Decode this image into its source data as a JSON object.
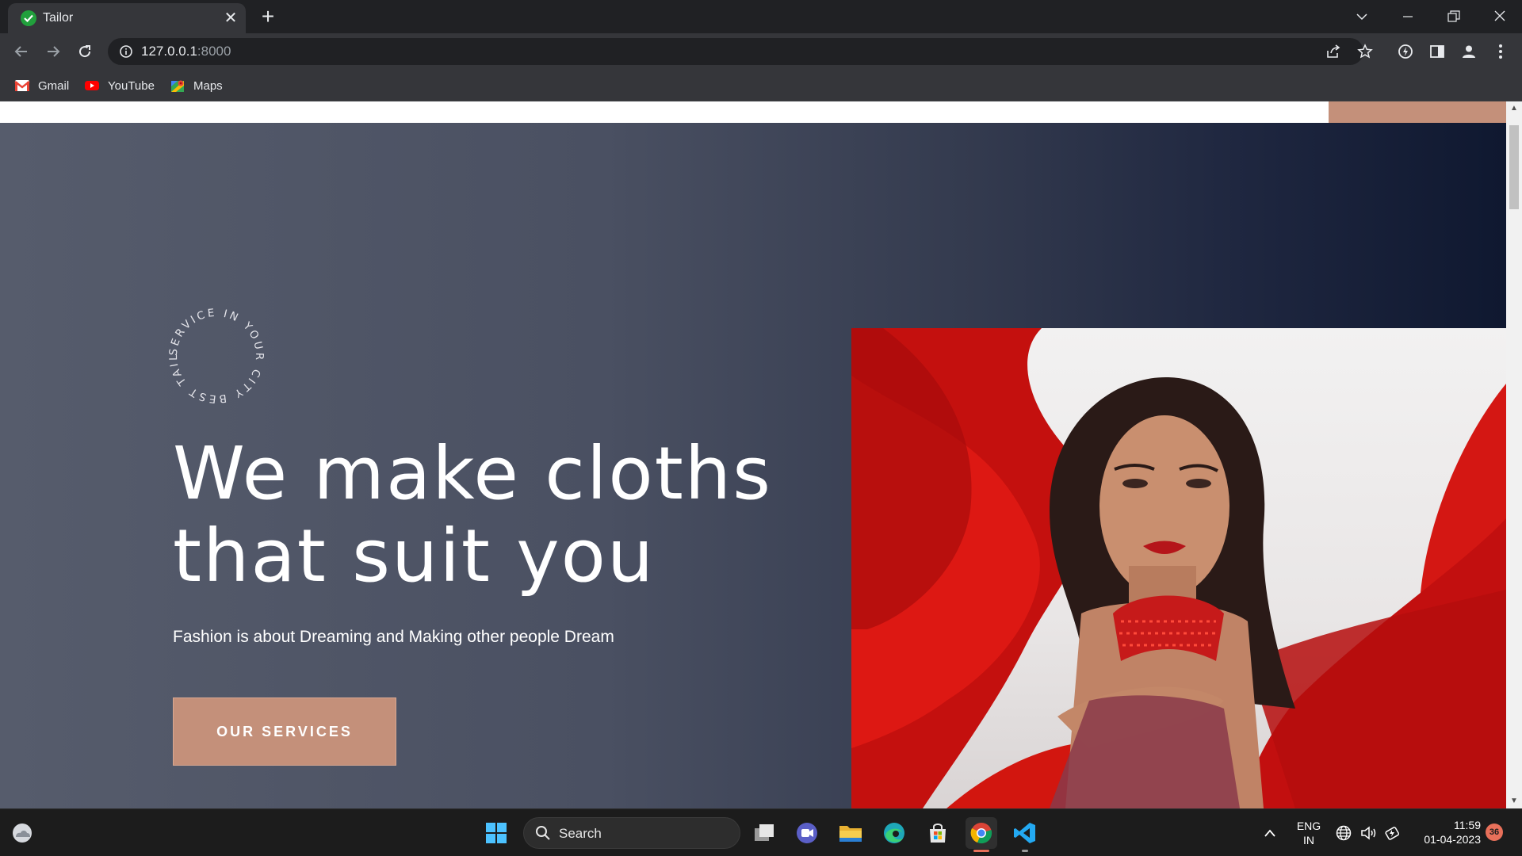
{
  "browser": {
    "tab": {
      "title": "Tailor"
    },
    "address": {
      "host": "127.0.0.1",
      "port": ":8000"
    },
    "bookmarks": [
      {
        "label": "Gmail",
        "icon": "gmail-icon"
      },
      {
        "label": "YouTube",
        "icon": "youtube-icon"
      },
      {
        "label": "Maps",
        "icon": "maps-icon"
      }
    ]
  },
  "page": {
    "badge_text": "SERVICE IN YOUR CITY BEST TAILOR",
    "headline_line1": "We make cloths",
    "headline_line2": "that suit you",
    "tagline": "Fashion is about Dreaming and Making other people Dream",
    "cta_label": "OUR SERVICES",
    "colors": {
      "accent": "#c4907a",
      "hero_left": "#565c6c",
      "hero_right": "#0f1830"
    }
  },
  "taskbar": {
    "search_label": "Search",
    "language": "ENG",
    "region": "IN",
    "time": "11:59",
    "date": "01-04-2023",
    "notification_count": "36"
  }
}
